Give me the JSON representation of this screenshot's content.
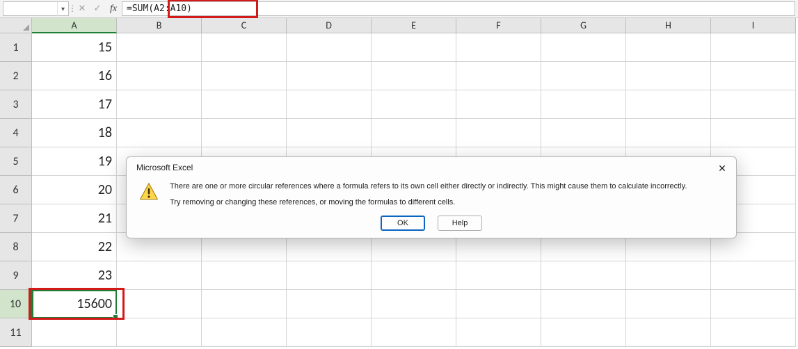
{
  "formula_bar": {
    "name_box": "",
    "cancel_glyph": "✕",
    "confirm_glyph": "✓",
    "fx_label": "fx",
    "formula": "=SUM(A2:A10)"
  },
  "columns": [
    "A",
    "B",
    "C",
    "D",
    "E",
    "F",
    "G",
    "H",
    "I"
  ],
  "active_column_index": 0,
  "rows": [
    1,
    2,
    3,
    4,
    5,
    6,
    7,
    8,
    9,
    10,
    11
  ],
  "active_row_index": 9,
  "cell_data": {
    "A": {
      "1": "15",
      "2": "16",
      "3": "17",
      "4": "18",
      "5": "19",
      "6": "20",
      "7": "21",
      "8": "22",
      "9": "23",
      "10": "15600"
    }
  },
  "selected_cell": "A10",
  "dialog": {
    "title": "Microsoft Excel",
    "line1": "There are one or more circular references where a formula refers to its own cell either directly or indirectly. This might cause them to calculate incorrectly.",
    "line2": "Try removing or changing these references, or moving the formulas to different cells.",
    "ok_label": "OK",
    "help_label": "Help",
    "close_glyph": "✕"
  }
}
